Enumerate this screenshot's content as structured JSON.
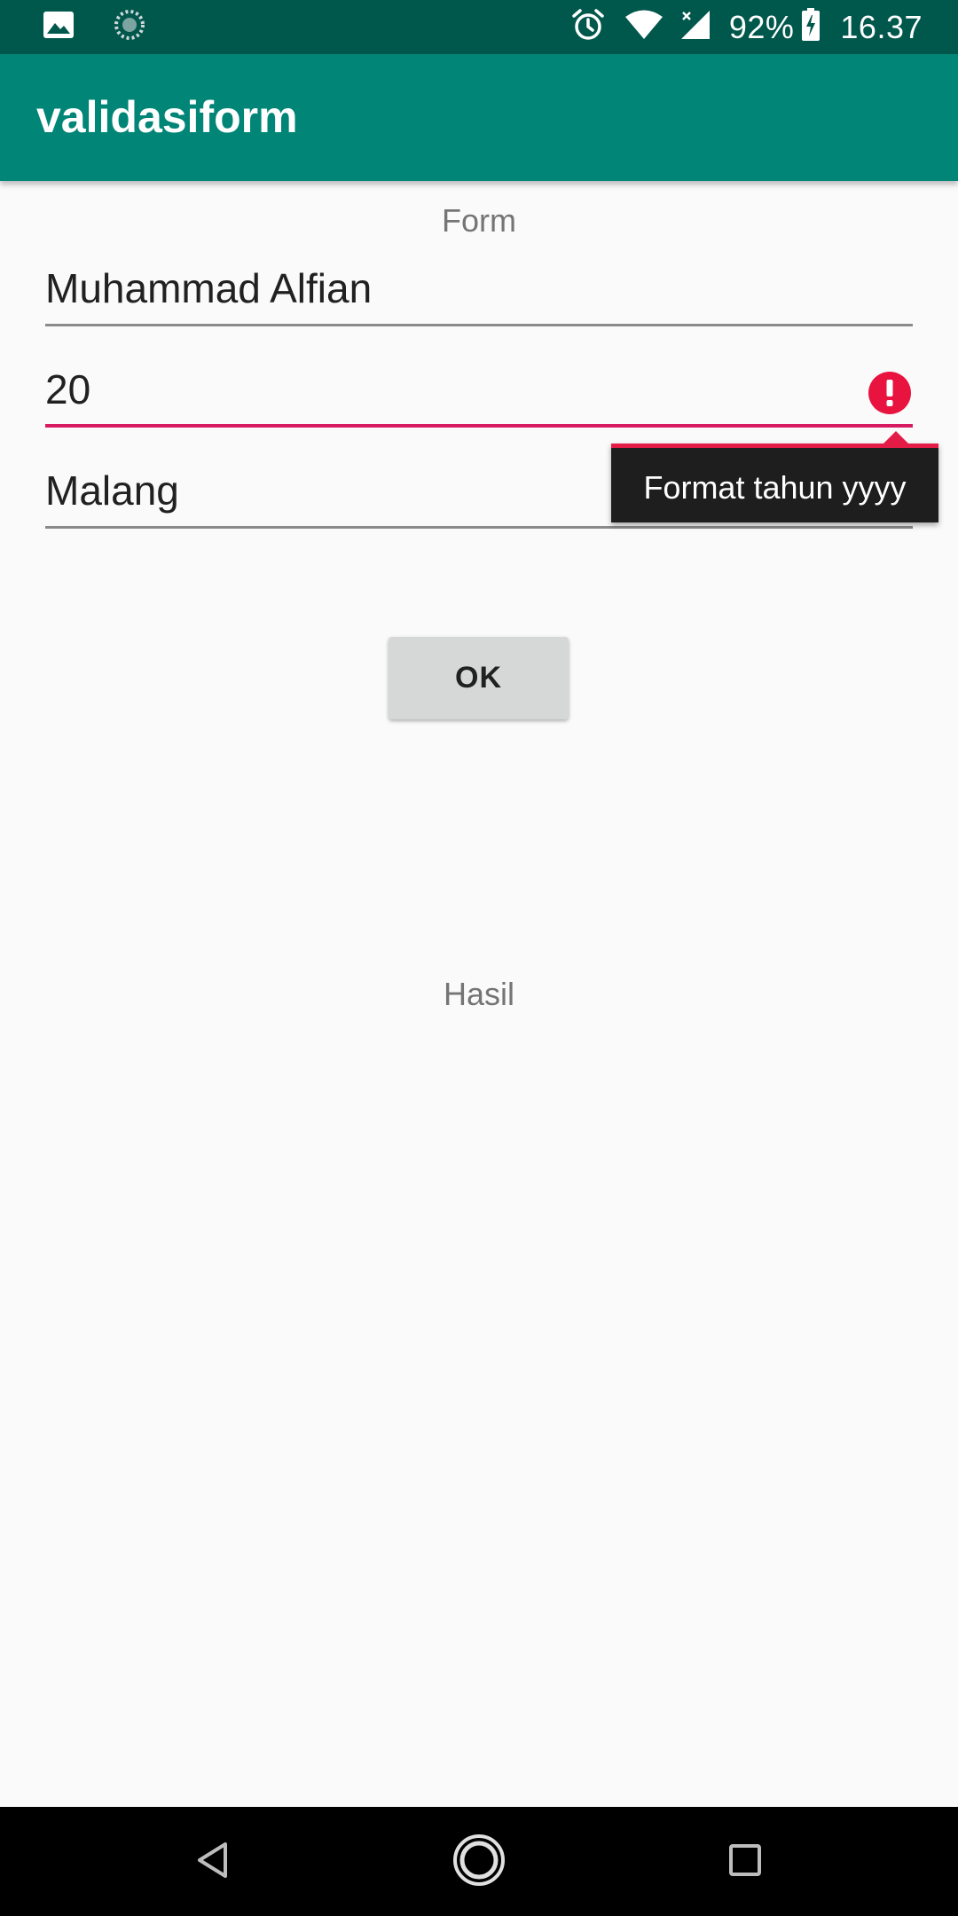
{
  "status_bar": {
    "battery": "92%",
    "time": "16.37",
    "icons": [
      "image-icon",
      "sync-icon",
      "alarm-icon",
      "wifi-icon",
      "signal-icon",
      "battery-charging-icon"
    ]
  },
  "app_bar": {
    "title": "validasiform"
  },
  "form": {
    "label": "Form",
    "fields": [
      {
        "value": "Muhammad Alfian"
      },
      {
        "value": "20",
        "error": "Format tahun yyyy"
      },
      {
        "value": "Malang"
      }
    ],
    "ok_label": "OK"
  },
  "result": {
    "label": "Hasil"
  },
  "nav_bar": {
    "icons": [
      "back-icon",
      "home-icon",
      "recents-icon"
    ]
  },
  "colors": {
    "status_bar": "#00574b",
    "app_bar": "#008577",
    "error": "#d81b60",
    "background": "#fafafa"
  }
}
